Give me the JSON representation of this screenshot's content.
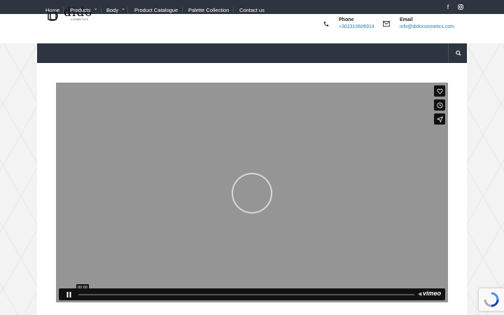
{
  "topbar": {
    "social": [
      {
        "name": "facebook-icon",
        "glyph": "f"
      },
      {
        "name": "instagram-icon",
        "glyph": "◎"
      }
    ]
  },
  "header": {
    "logo_text": "dido",
    "logo_subtext": "COSMETICS",
    "phone": {
      "label": "Phone",
      "value": "+302310606914",
      "icon": "phone-icon"
    },
    "email": {
      "label": "Email",
      "value": "info@didocosmetics.com",
      "icon": "envelope-icon"
    }
  },
  "nav": {
    "items": [
      {
        "label": "Home",
        "has_dropdown": false
      },
      {
        "label": "Products",
        "has_dropdown": true
      },
      {
        "label": "Body",
        "has_dropdown": true
      },
      {
        "label": "Product Catalogue",
        "has_dropdown": false
      },
      {
        "label": "Palette Collection",
        "has_dropdown": false
      },
      {
        "label": "Contact us",
        "has_dropdown": false
      }
    ],
    "dropdown_glyph": "⌄",
    "search_icon": "search-icon"
  },
  "video": {
    "side_buttons": [
      "heart-icon",
      "clock-icon",
      "send-icon"
    ],
    "play_state": "paused",
    "time": "00:00",
    "brand": "vimeo"
  },
  "colors": {
    "dark": "#2e3440",
    "link": "#1f7ea9",
    "video_bg": "#959595"
  }
}
